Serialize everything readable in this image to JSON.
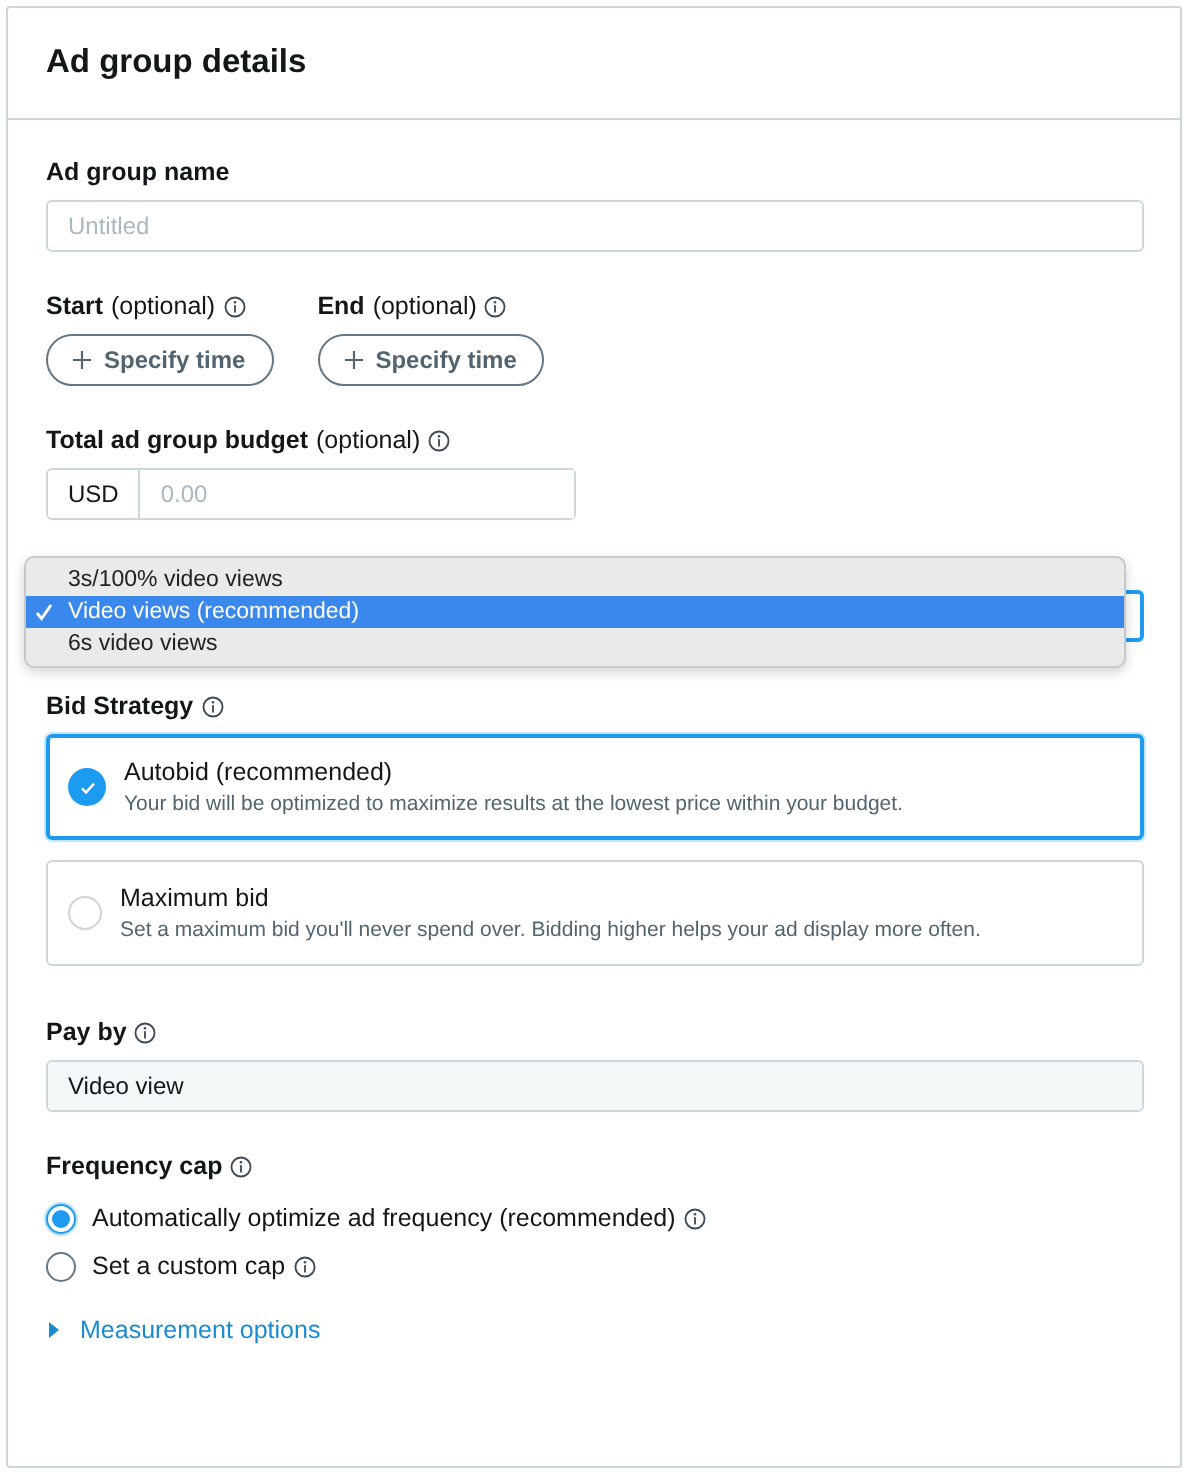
{
  "header": {
    "title": "Ad group details"
  },
  "name_field": {
    "label": "Ad group name",
    "info": false,
    "placeholder": "Untitled"
  },
  "schedule": [
    {
      "label": "Start",
      "note": "(optional)",
      "info": true,
      "button": "Specify time"
    },
    {
      "label": "End",
      "note": "(optional)",
      "info": true,
      "button": "Specify time"
    }
  ],
  "budget": {
    "label": "Total ad group budget",
    "note": "(optional)",
    "info": true,
    "currency": "USD",
    "placeholder": "0.00"
  },
  "goal_dropdown": {
    "options": [
      {
        "label": "3s/100% video views",
        "selected": false
      },
      {
        "label": "Video views (recommended)",
        "selected": true
      },
      {
        "label": "6s video views",
        "selected": false
      }
    ]
  },
  "bid_strategy": {
    "label": "Bid Strategy",
    "info": true,
    "options": [
      {
        "title": "Autobid (recommended)",
        "description": "Your bid will be optimized to maximize results at the lowest price within your budget.",
        "selected": true
      },
      {
        "title": "Maximum bid",
        "description": "Set a maximum bid you'll never spend over. Bidding higher helps your ad display more often.",
        "selected": false
      }
    ]
  },
  "pay_by": {
    "label": "Pay by",
    "info": true,
    "value": "Video view"
  },
  "frequency_cap": {
    "label": "Frequency cap",
    "info": true,
    "options": [
      {
        "label": "Automatically optimize ad frequency (recommended)",
        "info": true,
        "selected": true
      },
      {
        "label": "Set a custom cap",
        "info": true,
        "selected": false
      }
    ]
  },
  "measurement": {
    "label": "Measurement options",
    "expanded": false
  }
}
